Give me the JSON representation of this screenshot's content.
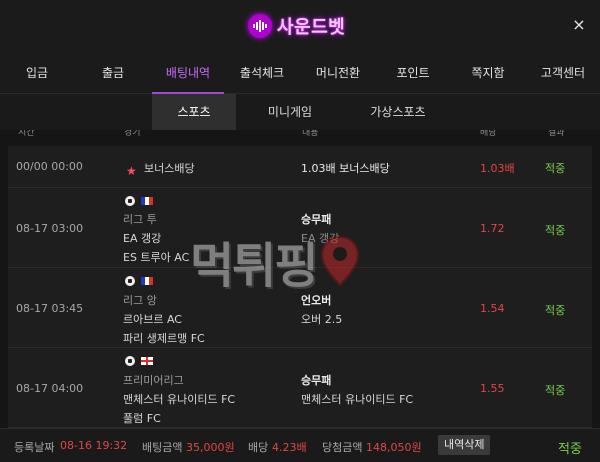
{
  "header": {
    "logo_text": "사운드벳",
    "close_label": "×"
  },
  "tabs": [
    {
      "label": "입금"
    },
    {
      "label": "출금"
    },
    {
      "label": "배팅내역"
    },
    {
      "label": "출석체크"
    },
    {
      "label": "머니전환"
    },
    {
      "label": "포인트"
    },
    {
      "label": "쪽지함"
    },
    {
      "label": "고객센터"
    }
  ],
  "active_tab": "배팅내역",
  "subtabs": [
    {
      "label": "스포츠"
    },
    {
      "label": "미니게임"
    },
    {
      "label": "가상스포츠"
    }
  ],
  "columns": {
    "time": "시간",
    "game": "경기",
    "content": "내용",
    "odds": "배당",
    "result": "결과"
  },
  "rows": [
    {
      "time": "00/00 00:00",
      "game": "보너스배당",
      "type": "1.03배 보너스배당",
      "odds": "1.03배",
      "result": "적중"
    },
    {
      "time": "08-17 03:00",
      "league": "리그 투",
      "home": "EA 갱강",
      "away": "ES 트루아 AC",
      "type": "승무패",
      "pick": "EA 갱강",
      "odds": "1.72",
      "result": "적중"
    },
    {
      "time": "08-17 03:45",
      "league": "리그 앙",
      "home": "르아브르 AC",
      "away": "파리 생제르맹 FC",
      "type": "언오버",
      "pick": "오버 2.5",
      "odds": "1.54",
      "result": "적중"
    },
    {
      "time": "08-17 04:00",
      "league": "프리미어리그",
      "home": "맨체스터 유나이티드 FC",
      "away": "풀럼 FC",
      "type": "승무패",
      "pick": "맨체스터 유나이티드 FC",
      "odds": "1.55",
      "result": "적중"
    }
  ],
  "footer": {
    "date_label": "등록날짜",
    "date_value": "08-16 19:32",
    "amount_label": "배팅금액",
    "amount_value": "35,000원",
    "odds_label": "배당",
    "odds_value": "4.23배",
    "win_label": "당첨금액",
    "win_value": "148,050원",
    "delete_label": "내역삭제",
    "result": "적중"
  },
  "watermark_text": "먹튀핑",
  "colors": {
    "accent": "#c86bff",
    "odds": "#e14646",
    "win": "#77d14a"
  }
}
